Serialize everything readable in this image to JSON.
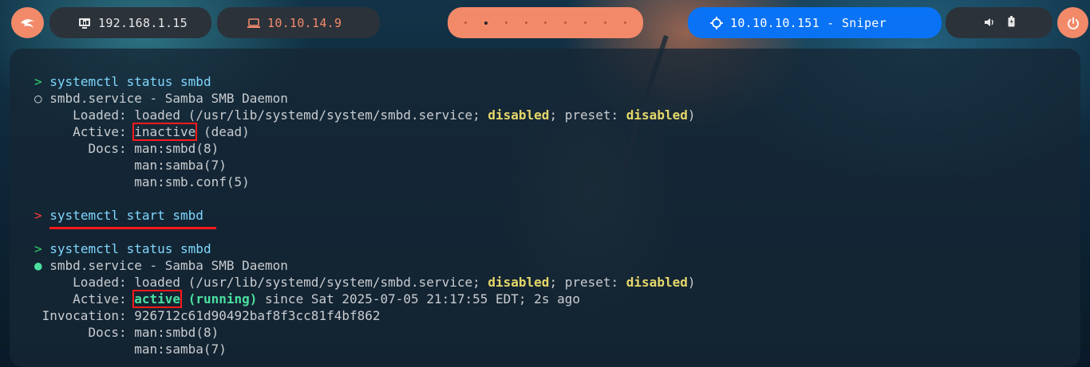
{
  "topbar": {
    "local_ip": "192.168.1.15",
    "vpn_ip": "10.10.14.9",
    "target": "10.10.10.151 - Sniper",
    "workspaces_count": 9,
    "active_workspace": 2
  },
  "terminal": {
    "block1": {
      "prompt": ">",
      "command": "systemctl status smbd",
      "bullet": "○",
      "service": "smbd.service - Samba SMB Daemon",
      "loaded_label": "Loaded:",
      "loaded_value_prefix": "loaded (/usr/lib/systemd/system/smbd.service;",
      "disabled": "disabled",
      "preset_text": "; preset:",
      "preset_value": "disabled",
      "close_paren": ")",
      "active_label": "Active:",
      "active_state": "inactive",
      "active_rest": "(dead)",
      "docs_label": "Docs:",
      "docs": [
        "man:smbd(8)",
        "man:samba(7)",
        "man:smb.conf(5)"
      ]
    },
    "block2": {
      "prompt": ">",
      "command": "systemctl start smbd"
    },
    "block3": {
      "prompt": ">",
      "command": "systemctl status smbd",
      "bullet": "●",
      "service": "smbd.service - Samba SMB Daemon",
      "loaded_label": "Loaded:",
      "loaded_value_prefix": "loaded (/usr/lib/systemd/system/smbd.service;",
      "disabled": "disabled",
      "preset_text": "; preset:",
      "preset_value": "disabled",
      "close_paren": ")",
      "active_label": "Active:",
      "active_state": "active",
      "active_running": "(running)",
      "active_since": "since Sat 2025-07-05 21:17:55 EDT; 2s ago",
      "invocation_label": "Invocation:",
      "invocation_id": "926712c61d90492baf8f3cc81f4bf862",
      "docs_label": "Docs:",
      "docs": [
        "man:smbd(8)",
        "man:samba(7)"
      ]
    }
  },
  "colors": {
    "accent_orange": "#f28a6a",
    "accent_blue": "#0a73f5",
    "highlight_red": "#ff1a1a",
    "prompt_green": "#33d06b",
    "status_green": "#4be0a0",
    "keyword_yellow": "#e5d76a"
  },
  "icons": {
    "launcher": "kali-dragon-icon",
    "local_ip": "monitor-icon",
    "vpn_ip": "laptop-icon",
    "target": "crosshair-icon",
    "volume": "volume-icon",
    "battery": "battery-icon",
    "power": "power-icon"
  }
}
